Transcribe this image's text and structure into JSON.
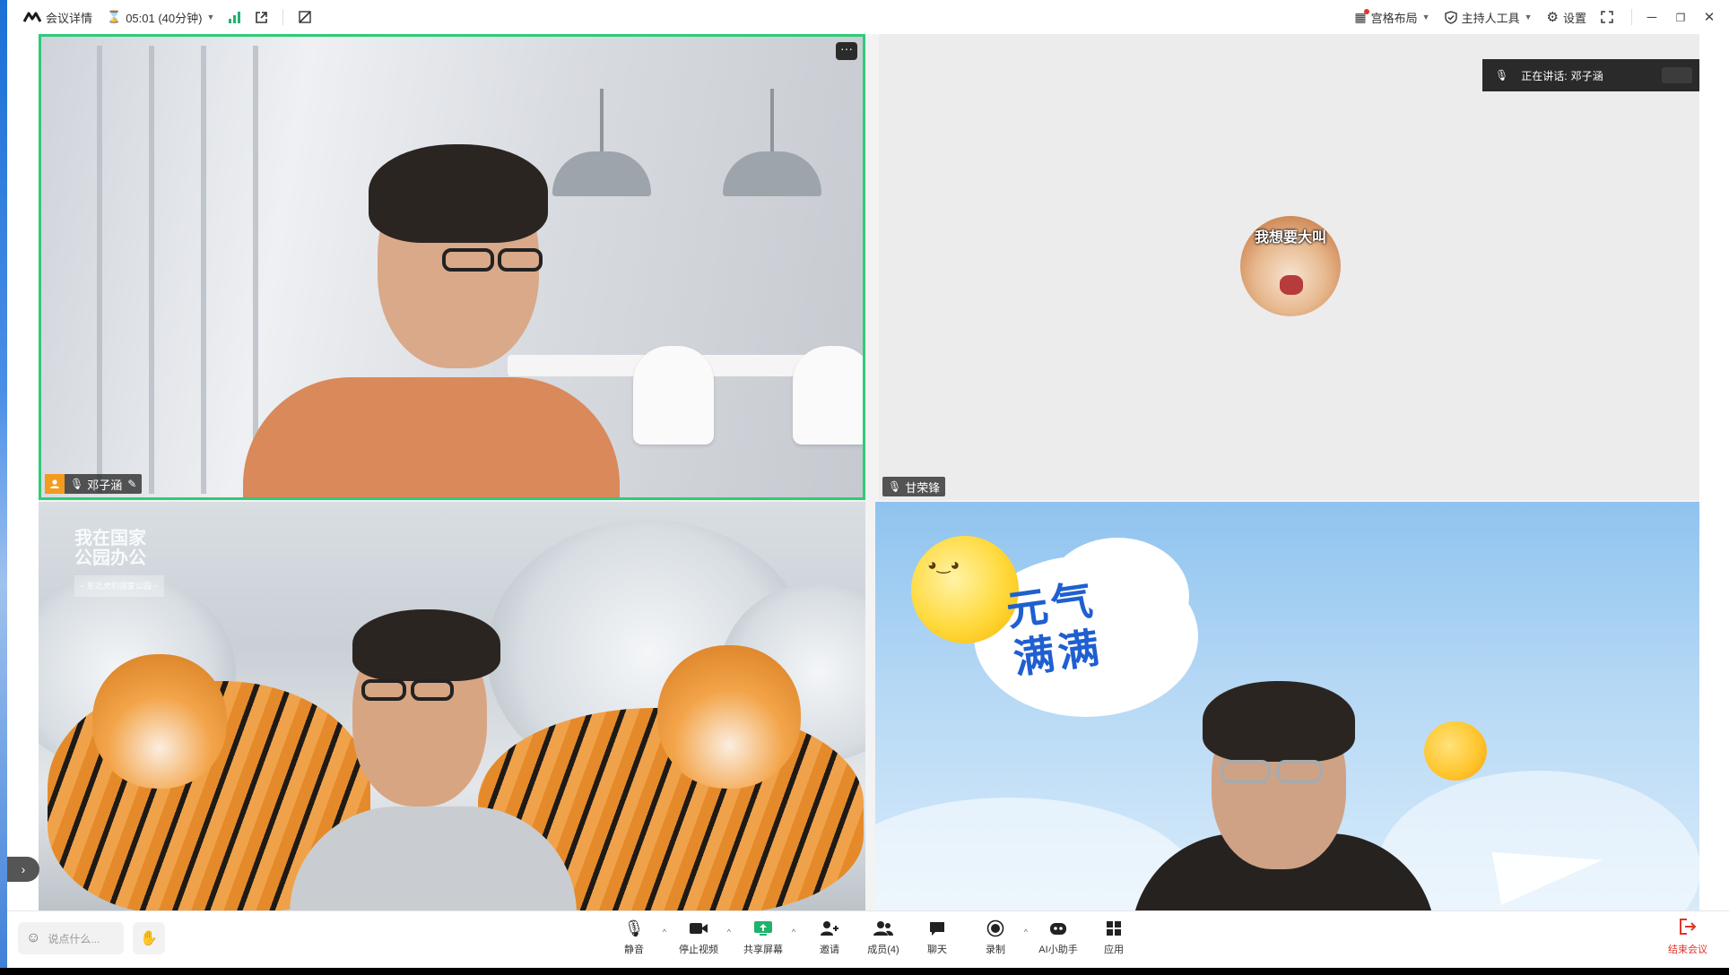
{
  "topbar": {
    "meeting_details": "会议详情",
    "timer": "05:01 (40分钟)",
    "layout_label": "宫格布局",
    "host_tools_label": "主持人工具",
    "settings_label": "设置"
  },
  "tiles": [
    {
      "name": "邓子涵",
      "is_host": true,
      "active_speaker_border": "#2ecb78"
    },
    {
      "name": "甘荣锋",
      "avatar_caption": "我想要大叫"
    },
    {
      "name": ""
    },
    {
      "name": ""
    }
  ],
  "speaking": {
    "label": "正在讲话:",
    "name": "邓子涵"
  },
  "tile3_watermark": {
    "line1": "我在国家",
    "line2": "公园办公",
    "sub": "~ 东北虎豹国家公园 ~"
  },
  "tile4_sticker": {
    "line1": "元气",
    "line2": "满满"
  },
  "toolbar": {
    "chat_placeholder": "说点什么...",
    "mute": "静音",
    "stop_video": "停止视频",
    "share_screen": "共享屏幕",
    "invite": "邀请",
    "members": "成员(4)",
    "chat": "聊天",
    "record": "录制",
    "ai_assistant": "AI小助手",
    "apps": "应用",
    "end_meeting": "结束会议"
  },
  "colors": {
    "accent_green": "#2ecb78",
    "end_red": "#e0352b",
    "host_orange": "#f29b1d",
    "share_green": "#1fb36b"
  }
}
